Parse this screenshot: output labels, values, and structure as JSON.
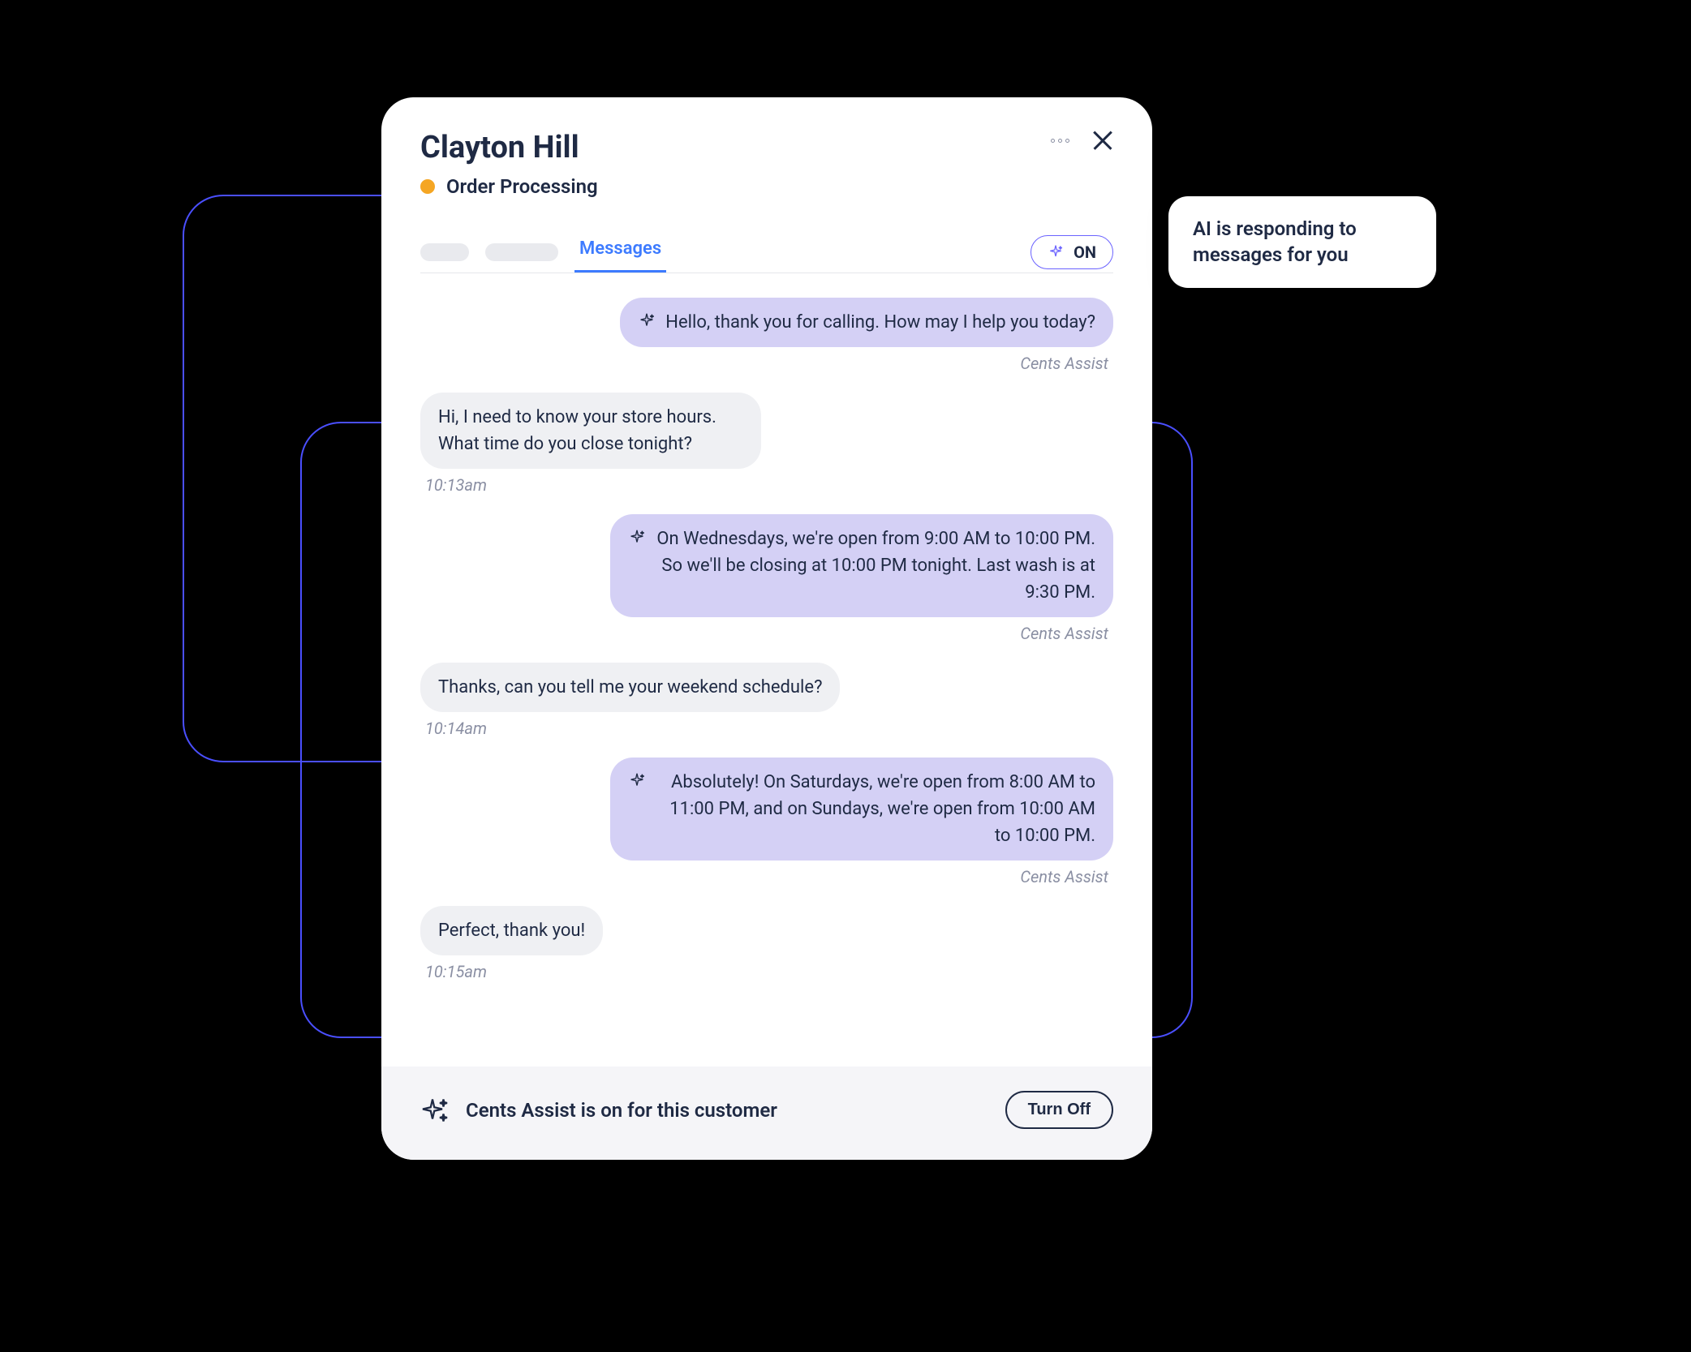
{
  "header": {
    "customer_name": "Clayton Hill",
    "status_label": "Order Processing",
    "tab_label": "Messages",
    "toggle_label": "ON"
  },
  "tooltip": {
    "text": "AI is responding to messages for you"
  },
  "messages": [
    {
      "type": "ai",
      "text": "Hello, thank you for calling. How may I help you today?",
      "sender": "Cents Assist"
    },
    {
      "type": "user",
      "text": "Hi, I need to know your store hours. What time do you close tonight?",
      "timestamp": "10:13am"
    },
    {
      "type": "ai",
      "text": "On Wednesdays, we're open from 9:00 AM to 10:00 PM. So we'll be closing at 10:00 PM tonight. Last wash is at 9:30 PM.",
      "sender": "Cents Assist"
    },
    {
      "type": "user",
      "text": "Thanks, can you tell me your weekend schedule?",
      "timestamp": "10:14am"
    },
    {
      "type": "ai",
      "text": "Absolutely! On Saturdays, we're open from 8:00 AM to 11:00 PM, and on Sundays, we're open from 10:00 AM to 10:00 PM.",
      "sender": "Cents Assist"
    },
    {
      "type": "user",
      "text": "Perfect, thank you!",
      "timestamp": "10:15am"
    }
  ],
  "footer": {
    "status_text": "Cents Assist is on for this customer",
    "button_label": "Turn Off"
  }
}
